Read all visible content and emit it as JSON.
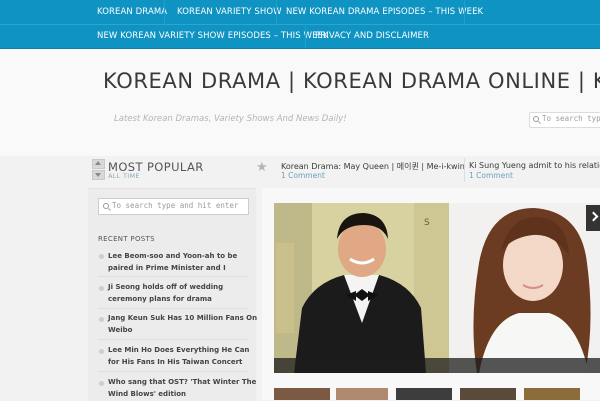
{
  "nav": {
    "items": [
      {
        "label": "KOREAN DRAMA"
      },
      {
        "label": "KOREAN VARIETY SHOW"
      },
      {
        "label": "NEW KOREAN DRAMA EPISODES – THIS WEEK"
      },
      {
        "label": "NEW KOREAN VARIETY SHOW EPISODES – THIS WEEK"
      },
      {
        "label": "PRIVACY AND DISCLAIMER"
      }
    ]
  },
  "header": {
    "title": "KOREAN DRAMA | KOREAN DRAMA ONLINE | KO",
    "tagline": "Latest Korean Dramas, Variety Shows And News Daily!",
    "search_placeholder": "To search type"
  },
  "most_popular": {
    "title": "MOST POPULAR",
    "period": "ALL TIME"
  },
  "trending": [
    {
      "title": "Korean Drama: May Queen | 메이퀸 | Me-i-kwin",
      "comments": "1 Comment"
    },
    {
      "title": "Ki Sung Yueng admit to his relationship",
      "comments": "1 Comment"
    }
  ],
  "sidebar": {
    "search_placeholder": "To search type and hit enter",
    "recent_heading": "RECENT POSTS",
    "posts": [
      {
        "title": "Lee Beom-soo and Yoon-ah to be paired in Prime Minister and I"
      },
      {
        "title": "Ji Seong holds off of wedding ceremony plans for drama"
      },
      {
        "title": "Jang Keun Suk Has 10 Million Fans On Weibo"
      },
      {
        "title": "Lee Min Ho Does Everything He Can for His Fans In His Taiwan Concert"
      },
      {
        "title": "Who sang that OST? 'That Winter The Wind Blows' edition"
      }
    ]
  },
  "colors": {
    "nav_bg": "#0f93c2",
    "accent_link": "#6aa3bd"
  },
  "icons": {
    "search": "magnifier-icon",
    "star": "star-icon",
    "up": "chevron-up-icon",
    "down": "chevron-down-icon",
    "next": "chevron-right-icon"
  }
}
